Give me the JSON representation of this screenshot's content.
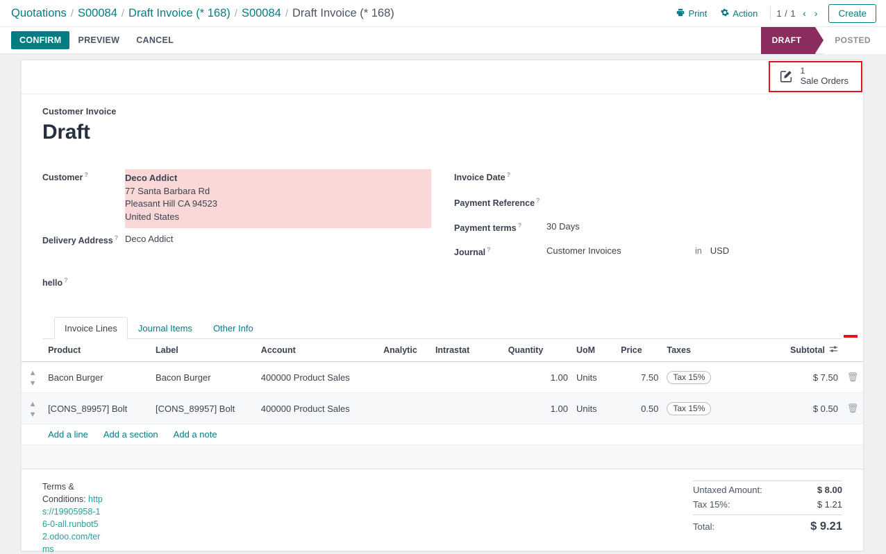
{
  "breadcrumb": {
    "items": [
      "Quotations",
      "S00084",
      "Draft Invoice (* 168)",
      "S00084",
      "Draft Invoice (* 168)"
    ],
    "separator": "/"
  },
  "control_panel": {
    "print_label": "Print",
    "action_label": "Action",
    "pager": "1 / 1",
    "prev_arrow": "‹",
    "next_arrow": "›",
    "create_label": "Create"
  },
  "statusbar_buttons": {
    "confirm": "CONFIRM",
    "preview": "PREVIEW",
    "cancel": "CANCEL"
  },
  "status_states": [
    {
      "label": "DRAFT",
      "active": true
    },
    {
      "label": "POSTED",
      "active": false
    }
  ],
  "smart_button": {
    "count": "1",
    "label": "Sale Orders",
    "highlight_color": "#e4131e"
  },
  "document": {
    "type_label": "Customer Invoice",
    "title": "Draft"
  },
  "fields_left": {
    "customer_label": "Customer",
    "customer_name": "Deco Addict",
    "customer_address": [
      "77 Santa Barbara Rd",
      "Pleasant Hill CA 94523",
      "United States"
    ],
    "customer_invalid_color": "#fbd8d8",
    "delivery_label": "Delivery Address",
    "delivery_value": "Deco Addict",
    "custom_label": "hello",
    "custom_value": ""
  },
  "fields_right": {
    "invoice_date_label": "Invoice Date",
    "invoice_date_value": "",
    "payment_reference_label": "Payment Reference",
    "payment_reference_value": "",
    "payment_terms_label": "Payment terms",
    "payment_terms_value": "30 Days",
    "journal_label": "Journal",
    "journal_value": "Customer Invoices",
    "journal_in": "in",
    "journal_currency": "USD"
  },
  "notebook": {
    "tabs": [
      {
        "label": "Invoice Lines",
        "active": true
      },
      {
        "label": "Journal Items",
        "active": false
      },
      {
        "label": "Other Info",
        "active": false
      }
    ]
  },
  "lines_table": {
    "headers": {
      "product": "Product",
      "label": "Label",
      "account": "Account",
      "analytic": "Analytic",
      "intrastat": "Intrastat",
      "quantity": "Quantity",
      "uom": "UoM",
      "price": "Price",
      "taxes": "Taxes",
      "subtotal": "Subtotal"
    },
    "rows": [
      {
        "product": "Bacon Burger",
        "label": "Bacon Burger",
        "account": "400000 Product Sales",
        "analytic": "",
        "intrastat": "",
        "quantity": "1.00",
        "uom": "Units",
        "price": "7.50",
        "tax": "Tax 15%",
        "subtotal": "$ 7.50"
      },
      {
        "product": "[CONS_89957] Bolt",
        "label": "[CONS_89957] Bolt",
        "account": "400000 Product Sales",
        "analytic": "",
        "intrastat": "",
        "quantity": "1.00",
        "uom": "Units",
        "price": "0.50",
        "tax": "Tax 15%",
        "subtotal": "$ 0.50"
      }
    ],
    "add_links": {
      "line": "Add a line",
      "section": "Add a section",
      "note": "Add a note"
    }
  },
  "footer": {
    "terms_label": "Terms & Conditions:",
    "terms_url": "https://19905958-16-0-all.runbot52.odoo.com/terms",
    "totals": {
      "untaxed_label": "Untaxed Amount:",
      "untaxed_value": "$ 8.00",
      "tax_label": "Tax 15%:",
      "tax_value": "$ 1.21",
      "total_label": "Total:",
      "total_value": "$ 9.21"
    }
  },
  "theme": {
    "primary": "#017e84",
    "status_active": "#8b2c5f",
    "link": "#24a19c"
  }
}
